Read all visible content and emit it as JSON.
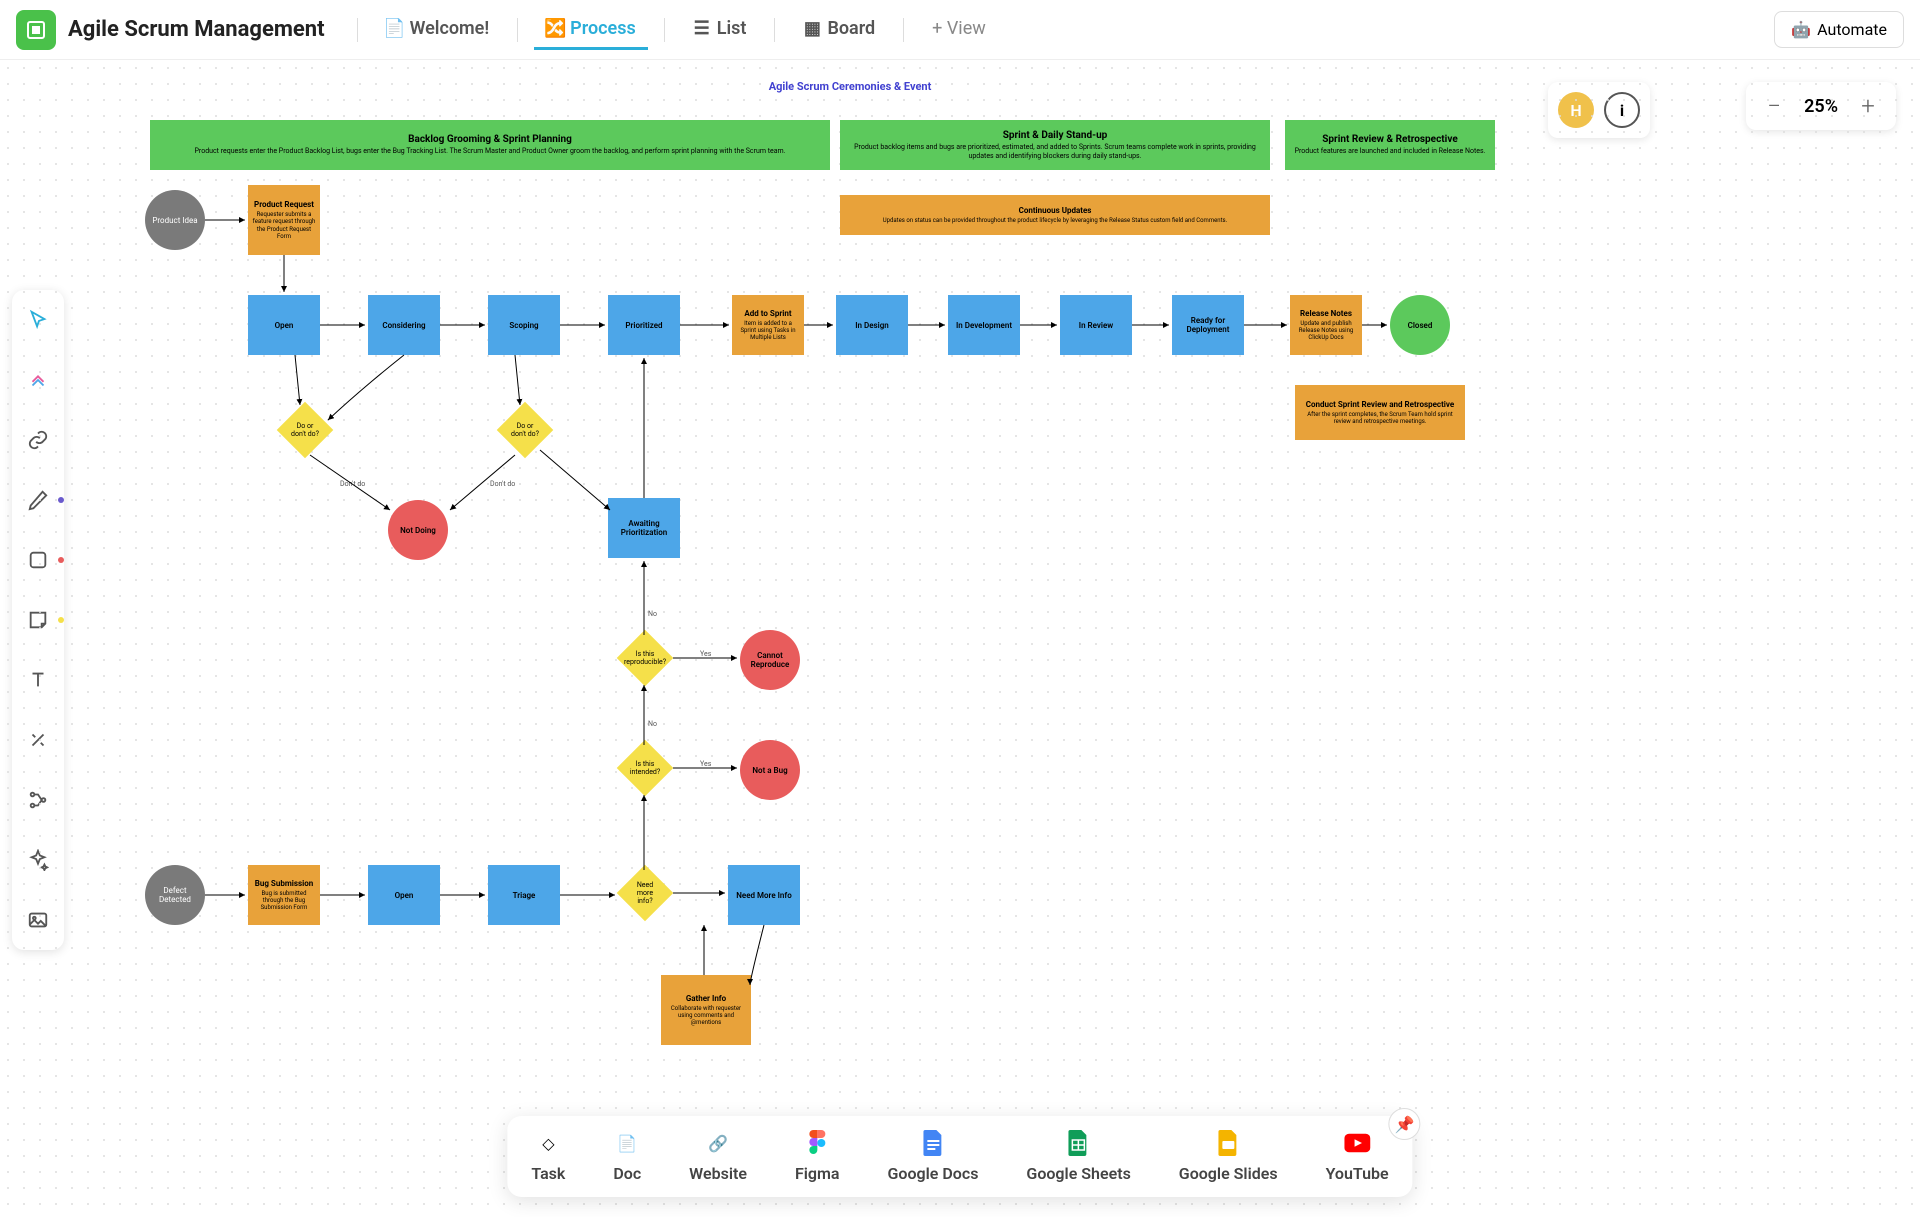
{
  "header": {
    "title": "Agile Scrum Management",
    "tabs": [
      {
        "label": "Welcome!",
        "icon": "doc"
      },
      {
        "label": "Process",
        "icon": "process",
        "active": true
      },
      {
        "label": "List",
        "icon": "list"
      },
      {
        "label": "Board",
        "icon": "board"
      }
    ],
    "addView": "+ View",
    "automate": "Automate"
  },
  "user": {
    "initial": "H"
  },
  "zoom": {
    "level": "25%"
  },
  "diagram": {
    "title": "Agile Scrum Ceremonies & Event",
    "bands": [
      {
        "id": "band1",
        "title": "Backlog Grooming & Sprint Planning",
        "sub": "Product requests enter the Product Backlog List, bugs enter the Bug Tracking List.\nThe Scrum Master and Product Owner groom the backlog, and perform sprint planning with the Scrum team."
      },
      {
        "id": "band2",
        "title": "Sprint & Daily Stand-up",
        "sub": "Product backlog items and bugs are prioritized, estimated, and added to Sprints. Scrum teams complete work in sprints, providing updates and identifying blockers during daily stand-ups."
      },
      {
        "id": "band3",
        "title": "Sprint Review & Retrospective",
        "sub": "Product features are launched and included in Release Notes."
      }
    ],
    "notes": {
      "productRequest": {
        "title": "Product Request",
        "sub": "Requester submits a feature request through the Product Request Form"
      },
      "continuousUpdates": {
        "title": "Continuous Updates",
        "sub": "Updates on status can be provided throughout the product lifecycle by leveraging the Release Status custom field and Comments."
      },
      "addToSprint": {
        "title": "Add to Sprint",
        "sub": "Item is added to a Sprint using Tasks in Multiple Lists"
      },
      "releaseNotes": {
        "title": "Release Notes",
        "sub": "Update and publish Release Notes using ClickUp Docs"
      },
      "retro": {
        "title": "Conduct Sprint Review and Retrospective",
        "sub": "After the sprint completes, the Scrum Team hold sprint review and retrospective meetings."
      },
      "bugSubmission": {
        "title": "Bug Submission",
        "sub": "Bug is submitted through the Bug Submission Form"
      },
      "gatherInfo": {
        "title": "Gather Info",
        "sub": "Collaborate with requester using comments and @mentions"
      }
    },
    "circles": {
      "productIdea": "Product Idea",
      "defectDetected": "Defect Detected",
      "notDoing": "Not Doing",
      "cannotReproduce": "Cannot Reproduce",
      "notABug": "Not a Bug",
      "closed": "Closed"
    },
    "boxes": {
      "open": "Open",
      "considering": "Considering",
      "scoping": "Scoping",
      "prioritized": "Prioritized",
      "inDesign": "In Design",
      "inDev": "In Development",
      "inReview": "In Review",
      "readyDeploy": "Ready for Deployment",
      "awaiting": "Awaiting Prioritization",
      "open2": "Open",
      "triage": "Triage",
      "needMore": "Need More Info"
    },
    "diamonds": {
      "d1": "Do or don't do?",
      "d2": "Do or don't do?",
      "d3": "Is this reproducible?",
      "d4": "Is this intended?",
      "d5": "Need more info?"
    },
    "labels": {
      "dontdo1": "Don't do",
      "dontdo2": "Don't do",
      "no1": "No",
      "yes1": "Yes",
      "no2": "No",
      "yes2": "Yes"
    }
  },
  "dock": [
    {
      "label": "Task",
      "icon": "task"
    },
    {
      "label": "Doc",
      "icon": "doc"
    },
    {
      "label": "Website",
      "icon": "link"
    },
    {
      "label": "Figma",
      "icon": "figma"
    },
    {
      "label": "Google Docs",
      "icon": "gdoc"
    },
    {
      "label": "Google Sheets",
      "icon": "gsheet"
    },
    {
      "label": "Google Slides",
      "icon": "gslide"
    },
    {
      "label": "YouTube",
      "icon": "youtube"
    }
  ]
}
